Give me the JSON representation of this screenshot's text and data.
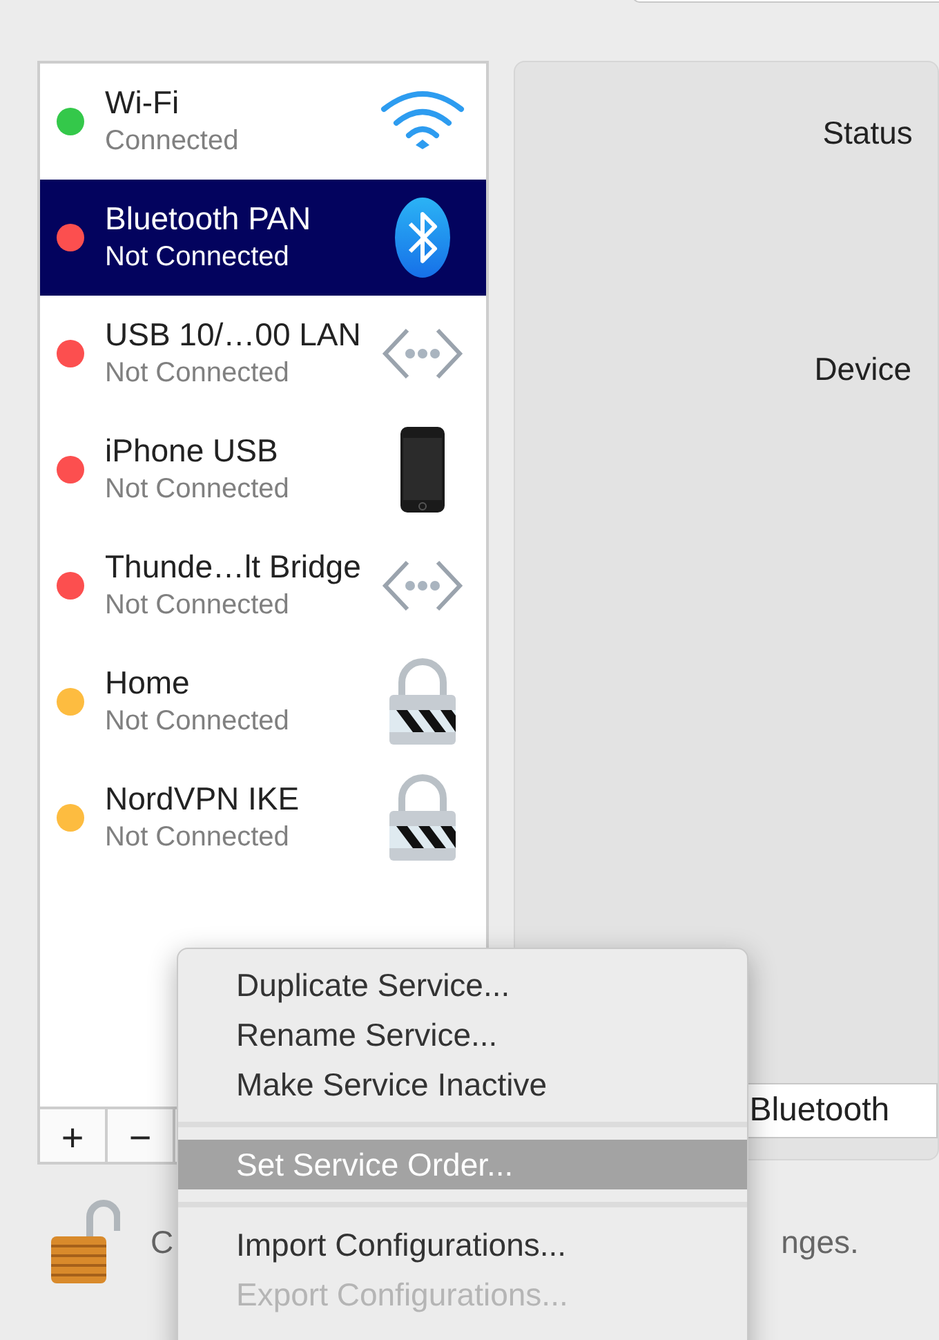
{
  "services": [
    {
      "name": "Wi-Fi",
      "status": "Connected",
      "color": "#34c84a",
      "kind": "wifi",
      "selected": false
    },
    {
      "name": "Bluetooth PAN",
      "status": "Not Connected",
      "color": "#fc4f4f",
      "kind": "bluetooth",
      "selected": true
    },
    {
      "name": "USB 10/…00 LAN",
      "status": "Not Connected",
      "color": "#fc4f4f",
      "kind": "ethernet",
      "selected": false
    },
    {
      "name": "iPhone USB",
      "status": "Not Connected",
      "color": "#fc4f4f",
      "kind": "phone",
      "selected": false
    },
    {
      "name": "Thunde…lt Bridge",
      "status": "Not Connected",
      "color": "#fc4f4f",
      "kind": "ethernet",
      "selected": false
    },
    {
      "name": "Home",
      "status": "Not Connected",
      "color": "#fdbc40",
      "kind": "vpn",
      "selected": false
    },
    {
      "name": "NordVPN IKE",
      "status": "Not Connected",
      "color": "#fdbc40",
      "kind": "vpn",
      "selected": false
    }
  ],
  "list_buttons": [
    "+",
    "−"
  ],
  "detail": {
    "status_label": "Status",
    "device_label": "Device",
    "device_value": "Bluetooth"
  },
  "footer": {
    "text_left": "C",
    "text_right": "nges."
  },
  "menu": [
    {
      "kind": "item",
      "label": "Duplicate Service...",
      "selected": false,
      "disabled": false
    },
    {
      "kind": "item",
      "label": "Rename Service...",
      "selected": false,
      "disabled": false
    },
    {
      "kind": "item",
      "label": "Make Service Inactive",
      "selected": false,
      "disabled": false
    },
    {
      "kind": "separator"
    },
    {
      "kind": "item",
      "label": "Set Service Order...",
      "selected": true,
      "disabled": false
    },
    {
      "kind": "separator"
    },
    {
      "kind": "item",
      "label": "Import Configurations...",
      "selected": false,
      "disabled": false
    },
    {
      "kind": "item",
      "label": "Export Configurations...",
      "selected": false,
      "disabled": true
    }
  ]
}
